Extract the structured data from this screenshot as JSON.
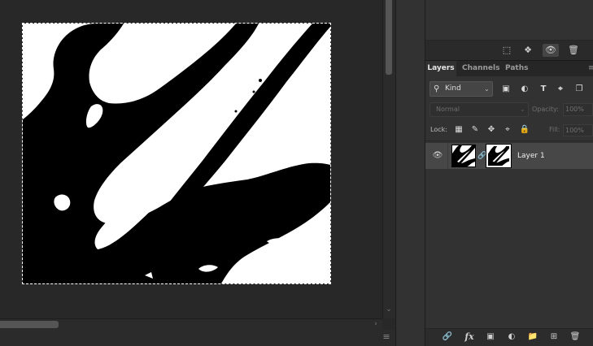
{
  "layers_panel": {
    "tabs": [
      {
        "label": "Layers",
        "active": true
      },
      {
        "label": "Channels",
        "active": false
      },
      {
        "label": "Paths",
        "active": false
      }
    ],
    "panel_menu_icon": "panel-menu-icon",
    "filter": {
      "kind_label": "Kind",
      "icons": [
        "pixel-filter-icon",
        "adjustment-filter-icon",
        "type-filter-icon",
        "shape-filter-icon",
        "smart-object-filter-icon"
      ]
    },
    "blend_mode": "Normal",
    "opacity_label": "Opacity:",
    "opacity_value": "100%",
    "lock_label": "Lock:",
    "fill_label": "Fill:",
    "fill_value": "100%",
    "layers": [
      {
        "name": "Layer 1",
        "visible": true,
        "has_mask": true,
        "selected": true
      }
    ],
    "bottom_icons": [
      "link-layers-icon",
      "fx-icon",
      "add-mask-icon",
      "adjustment-layer-icon",
      "new-group-icon",
      "new-layer-icon",
      "trash-icon"
    ],
    "fx_text": "fx"
  },
  "top_panel_icons": [
    "selection-icon",
    "target-icon",
    "eye-icon",
    "trash-icon"
  ],
  "colors": {
    "canvas_bg": "#282828",
    "panel_bg": "#323232",
    "selected_layer": "#474747",
    "artwork_ink": "#000000",
    "artwork_paper": "#ffffff"
  }
}
